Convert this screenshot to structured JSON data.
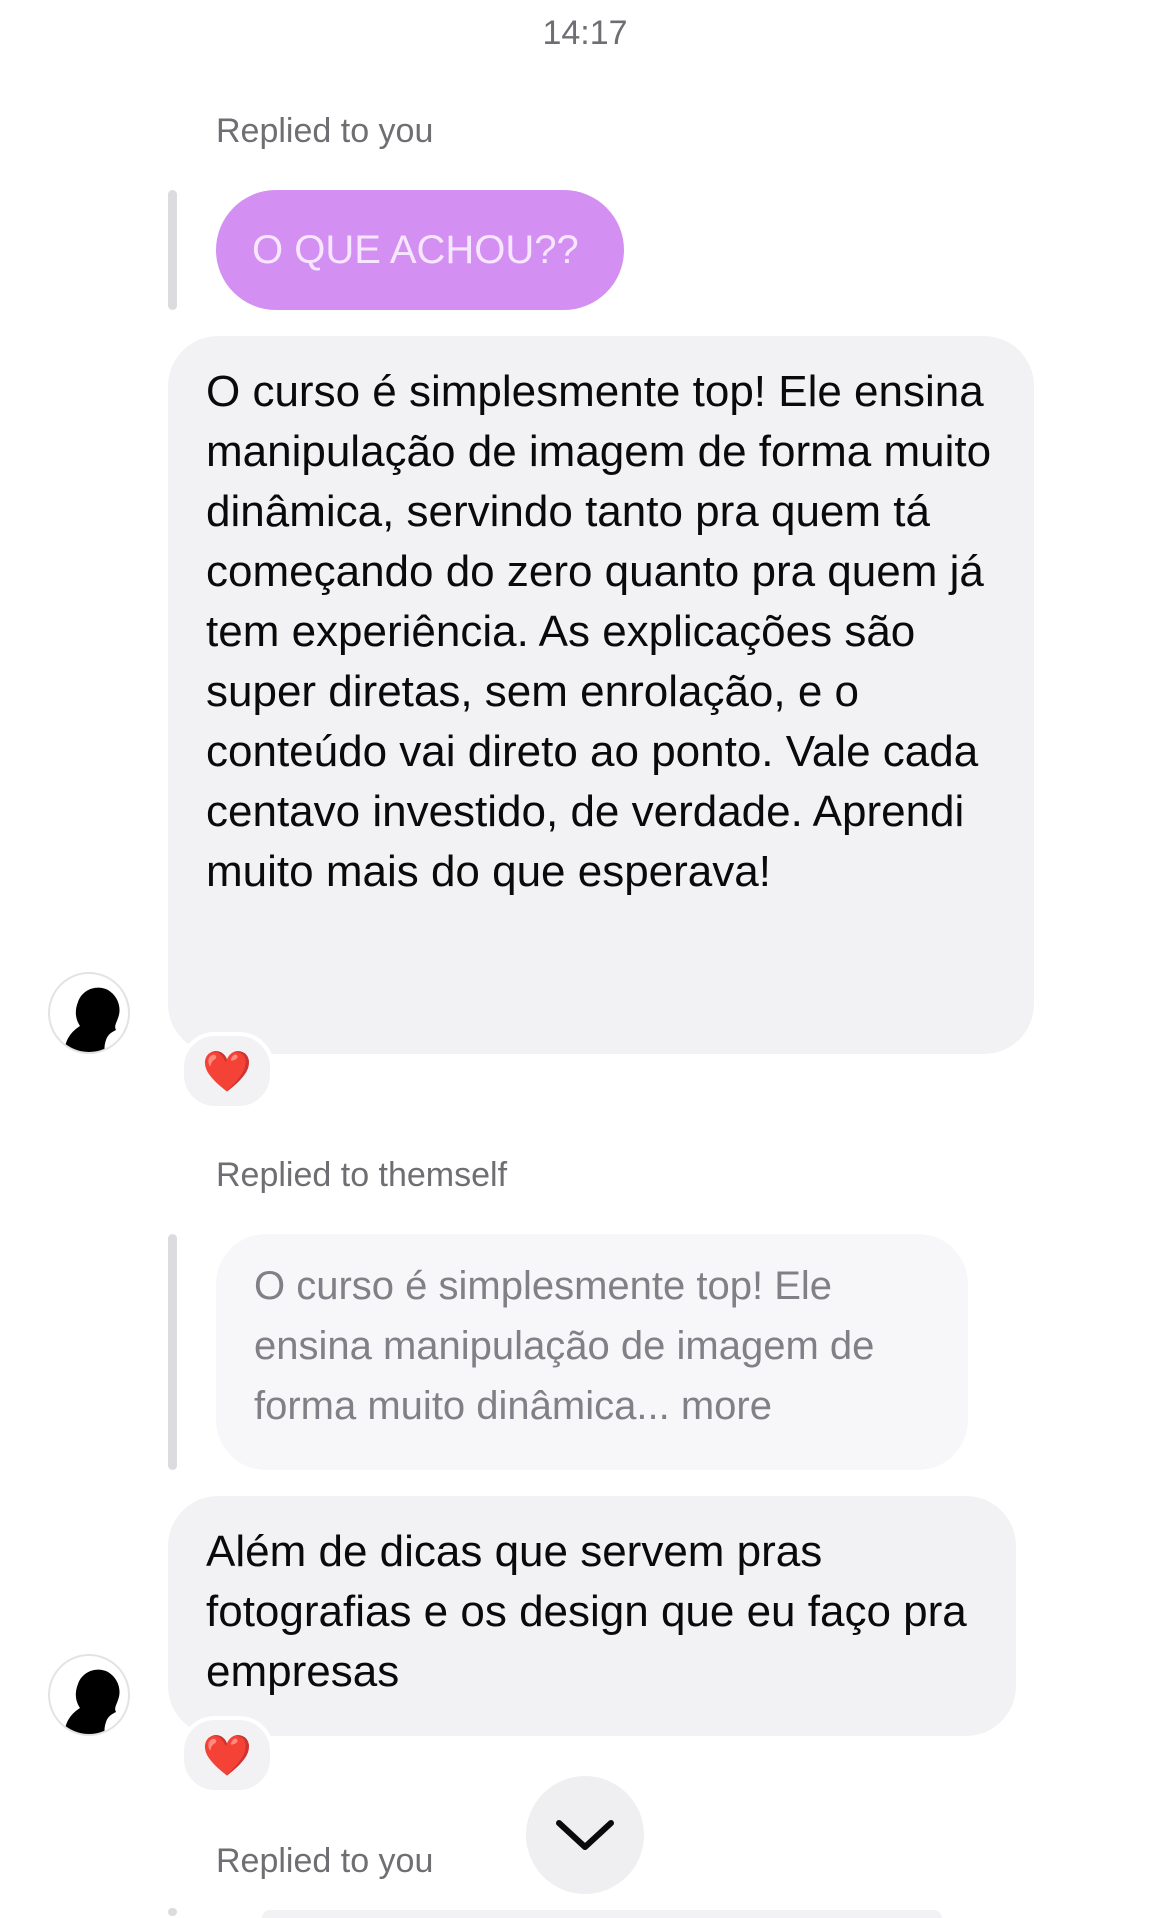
{
  "timestamp": "14:17",
  "messages": [
    {
      "reply_label": "Replied to you",
      "quoted_text": "O QUE ACHOU??",
      "text": "O curso é simplesmente top! Ele ensina manipulação de imagem de forma muito dinâmica, servindo tanto pra quem tá começando do zero quanto pra quem já tem experiência. As explicações são super diretas, sem enrolação, e o conteúdo vai direto ao ponto. Vale cada centavo investido, de verdade. Aprendi muito mais do que esperava!",
      "reaction": "❤️",
      "avatar_icon": "avatar-silhouette-icon"
    },
    {
      "reply_label": "Replied to themself",
      "quoted_text": "O curso é simplesmente top! Ele ensina manipulação de imagem de forma muito dinâmica... more",
      "text": "Além de dicas que servem pras fotografias e os design que eu faço pra empresas",
      "reaction": "❤️",
      "avatar_icon": "avatar-silhouette-icon"
    },
    {
      "reply_label": "Replied to you"
    }
  ],
  "scroll_down_icon": "chevron-down-icon",
  "colors": {
    "purple_bubble": "#d38ff2",
    "gray_bubble": "#f2f2f4",
    "secondary_text": "#6e6e73"
  }
}
